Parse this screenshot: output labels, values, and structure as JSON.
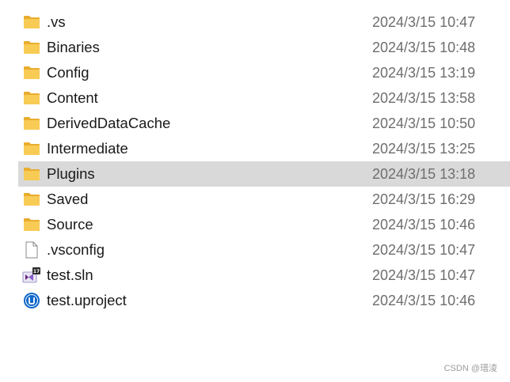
{
  "files": [
    {
      "name": ".vs",
      "modified": "2024/3/15 10:47",
      "icon": "folder-icon",
      "selected": false
    },
    {
      "name": "Binaries",
      "modified": "2024/3/15 10:48",
      "icon": "folder-icon",
      "selected": false
    },
    {
      "name": "Config",
      "modified": "2024/3/15 13:19",
      "icon": "folder-icon",
      "selected": false
    },
    {
      "name": "Content",
      "modified": "2024/3/15 13:58",
      "icon": "folder-icon",
      "selected": false
    },
    {
      "name": "DerivedDataCache",
      "modified": "2024/3/15 10:50",
      "icon": "folder-icon",
      "selected": false
    },
    {
      "name": "Intermediate",
      "modified": "2024/3/15 13:25",
      "icon": "folder-icon",
      "selected": false
    },
    {
      "name": "Plugins",
      "modified": "2024/3/15 13:18",
      "icon": "folder-icon",
      "selected": true
    },
    {
      "name": "Saved",
      "modified": "2024/3/15 16:29",
      "icon": "folder-icon",
      "selected": false
    },
    {
      "name": "Source",
      "modified": "2024/3/15 10:46",
      "icon": "folder-icon",
      "selected": false
    },
    {
      "name": ".vsconfig",
      "modified": "2024/3/15 10:47",
      "icon": "file-icon",
      "selected": false
    },
    {
      "name": "test.sln",
      "modified": "2024/3/15 10:47",
      "icon": "visual-studio-solution-icon",
      "selected": false
    },
    {
      "name": "test.uproject",
      "modified": "2024/3/15 10:46",
      "icon": "unreal-project-icon",
      "selected": false
    }
  ],
  "colors": {
    "selection": "#d9d9d9",
    "folder": "#f6c64e",
    "date_text": "#6e6e6e"
  },
  "watermark": "CSDN @瑨淩"
}
